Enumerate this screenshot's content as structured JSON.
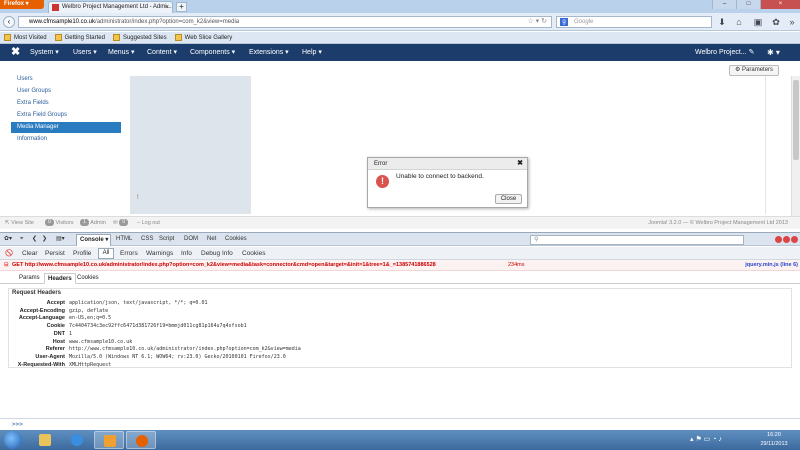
{
  "browser": {
    "firefox_button": "Firefox",
    "tab_title": "Welbro Project Management Ltd - Admi...",
    "new_tab": "+",
    "url_host": "www.cfmsample10.co.uk",
    "url_path": "/administrator/index.php?option=com_k2&view=media",
    "search_placeholder": "Google",
    "bookmarks": [
      "Most Visited",
      "Getting Started",
      "Suggested Sites",
      "Web Slice Gallery"
    ]
  },
  "joomla": {
    "menu": [
      "System ▾",
      "Users ▾",
      "Menus ▾",
      "Content ▾",
      "Components ▾",
      "Extensions ▾",
      "Help ▾"
    ],
    "site_name": "Welbro Project...",
    "params_button": "Parameters",
    "sidebar": [
      "Users",
      "User Groups",
      "Extra Fields",
      "Extra Field Groups",
      "Media Manager",
      "Information"
    ],
    "sidebar_active": 4,
    "panel_marker": "!",
    "status": {
      "view_site": "View Site",
      "visitors_count": "0",
      "visitors": "Visitors",
      "admin_count": "1",
      "admin": "Admin",
      "messages_count": "0",
      "logout": "Log out",
      "footer": "Joomla! 3.2.0 — © Welbro Project Management Ltd 2013"
    }
  },
  "error_dialog": {
    "title": "Error",
    "message": "Unable to connect to backend.",
    "close_button": "Close"
  },
  "firebug": {
    "console_tab": "Console ▾",
    "tabs": [
      "HTML",
      "CSS",
      "Script",
      "DOM",
      "Net",
      "Cookies"
    ],
    "filters": [
      "Clear",
      "Persist",
      "Profile",
      "All",
      "Errors",
      "Warnings",
      "Info",
      "Debug Info",
      "Cookies"
    ],
    "request": {
      "method_url": "GET http://www.cfmsample10.co.uk/administrator/index.php?option=com_k2&view=media&task=connector&cmd=open&target=&init=1&tree=1&_=1385741886528",
      "time": "234ms",
      "source": "jquery.min.js (line 6)"
    },
    "subtabs": [
      "Params",
      "Headers",
      "Cookies"
    ],
    "subtab_active": 1,
    "headers_title": "Request Headers",
    "headers": [
      {
        "key": "Accept",
        "value": "application/json, text/javascript, */*; q=0.01"
      },
      {
        "key": "Accept-Encoding",
        "value": "gzip, deflate"
      },
      {
        "key": "Accept-Language",
        "value": "en-US,en;q=0.5"
      },
      {
        "key": "Cookie",
        "value": "7c4404734c3ec92ffc6471d381726f19=bmmjd011cg81p164u7q4sfsob1"
      },
      {
        "key": "DNT",
        "value": "1"
      },
      {
        "key": "Host",
        "value": "www.cfmsample10.co.uk"
      },
      {
        "key": "Referer",
        "value": "http://www.cfmsample10.co.uk/administrator/index.php?option=com_k2&view=media"
      },
      {
        "key": "User-Agent",
        "value": "Mozilla/5.0 (Windows NT 6.1; WOW64; rv:23.0) Gecko/20100101 Firefox/23.0"
      },
      {
        "key": "X-Requested-With",
        "value": "XMLHttpRequest"
      }
    ],
    "command_prompt": ">>>"
  },
  "taskbar": {
    "time": "16:20",
    "date": "29/11/2013"
  }
}
